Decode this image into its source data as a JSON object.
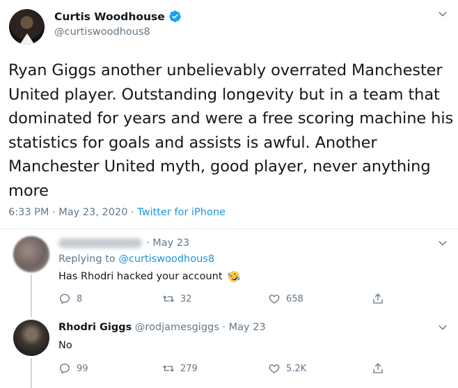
{
  "tweet": {
    "display_name": "Curtis Woodhouse",
    "handle": "@curtiswoodhous8",
    "text": "Ryan Giggs another unbelievably overrated Manchester United player. Outstanding longevity but in a team that dominated for years and were a free scoring machine his statistics for goals and assists is awful. Another Manchester United myth, good player, never anything more",
    "time": "6:33 PM",
    "date": "May 23, 2020",
    "source": "Twitter for iPhone",
    "separator": "·"
  },
  "replies": [
    {
      "date": "· May 23",
      "replying_label": "Replying to",
      "replying_to": "@curtiswoodhous8",
      "text": "Has Rhodri hacked your account",
      "emoji": "rolling-on-floor-laughing-emoji",
      "replies_count": "8",
      "retweets_count": "32",
      "likes_count": "658"
    },
    {
      "display_name": "Rhodri Giggs",
      "handle": "@rodjamesgiggs",
      "date": "· May 23",
      "text": "No",
      "replies_count": "99",
      "retweets_count": "279",
      "likes_count": "5.2K"
    }
  ],
  "colors": {
    "accent": "#1b95e0",
    "verified": "#1da1f2",
    "muted": "#657786",
    "text": "#14171a"
  }
}
